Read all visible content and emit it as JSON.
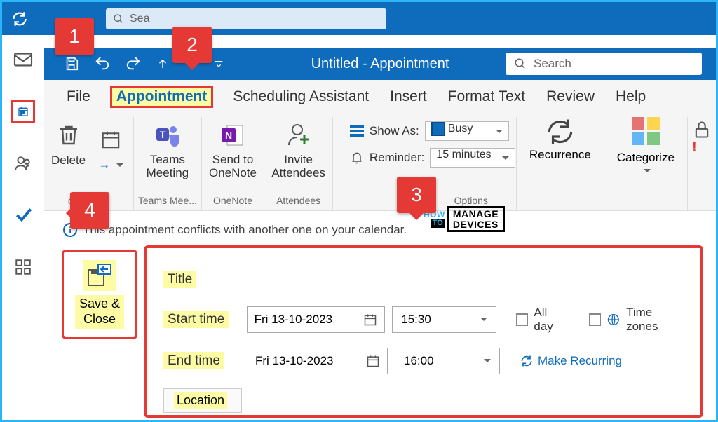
{
  "top": {
    "search_label": "Sea"
  },
  "title_bar": {
    "window_title": "Untitled  -  Appointment",
    "search_placeholder": "Search"
  },
  "tabs": {
    "file": "File",
    "appointment": "Appointment",
    "scheduling": "Scheduling Assistant",
    "insert": "Insert",
    "format": "Format Text",
    "review": "Review",
    "help": "Help"
  },
  "ribbon": {
    "delete": "Delete",
    "actions_group": "ons",
    "teams": "Teams\nMeeting",
    "teams_group": "Teams Mee...",
    "onenote": "Send to\nOneNote",
    "onenote_group": "OneNote",
    "invite": "Invite\nAttendees",
    "attendees_group": "Attendees",
    "options_group": "Options",
    "show_as_label": "Show As:",
    "show_as_value": "Busy",
    "reminder_label": "Reminder:",
    "reminder_value": "15 minutes",
    "recurrence": "Recurrence",
    "categorize": "Categorize"
  },
  "conflict_message": "This appointment conflicts with another one on your calendar.",
  "save_close": {
    "line1": "Save &",
    "line2": "Close"
  },
  "form": {
    "title_label": "Title",
    "start_label": "Start time",
    "end_label": "End time",
    "start_date": "Fri 13-10-2023",
    "start_time": "15:30",
    "end_date": "Fri 13-10-2023",
    "end_time": "16:00",
    "all_day": "All day",
    "time_zones": "Time zones",
    "make_recurring": "Make Recurring",
    "location_label": "Location"
  },
  "callouts": {
    "c1": "1",
    "c2": "2",
    "c3": "3",
    "c4": "4"
  },
  "watermark": {
    "how": "HOW",
    "to": "TO",
    "line1": "MANAGE",
    "line2": "DEVICES"
  }
}
